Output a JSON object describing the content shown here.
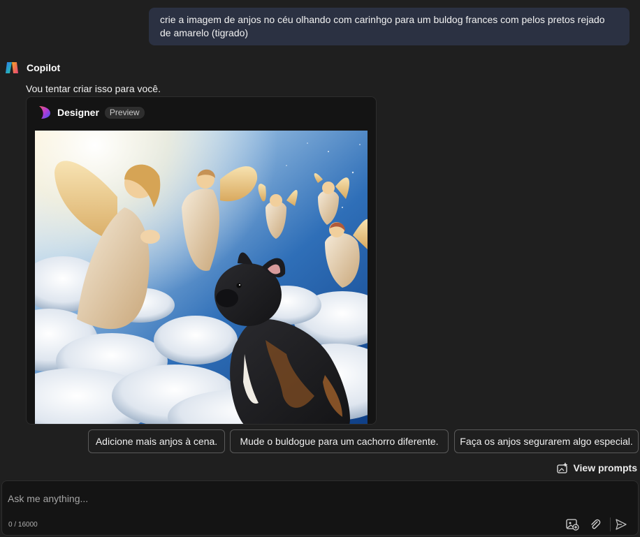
{
  "user_message": {
    "text": "crie a imagem de anjos no céu olhando com carinhgo para um buldog frances com pelos pretos rejado de amarelo (tigrado)"
  },
  "assistant": {
    "name": "Copilot",
    "logo_icon": "copilot-logo-icon",
    "reply": "Vou tentar criar isso para você."
  },
  "designer": {
    "title": "Designer",
    "badge": "Preview",
    "logo_icon": "designer-logo-icon",
    "image_subject": "angels-in-sky-looking-at-brindle-french-bulldog"
  },
  "suggestions": [
    "Adicione mais anjos à cena.",
    "Mude o buldogue para um cachorro diferente.",
    "Faça os anjos segurarem algo especial."
  ],
  "view_prompts": {
    "label": "View prompts",
    "icon": "sparkle-image-icon"
  },
  "composer": {
    "placeholder": "Ask me anything...",
    "value": "",
    "char_count": "0 / 16000",
    "icons": [
      "add-image-icon",
      "attach-icon",
      "send-icon"
    ]
  },
  "colors": {
    "background": "#1f1f1f",
    "user_bubble": "#2b3142",
    "card": "#141414"
  }
}
